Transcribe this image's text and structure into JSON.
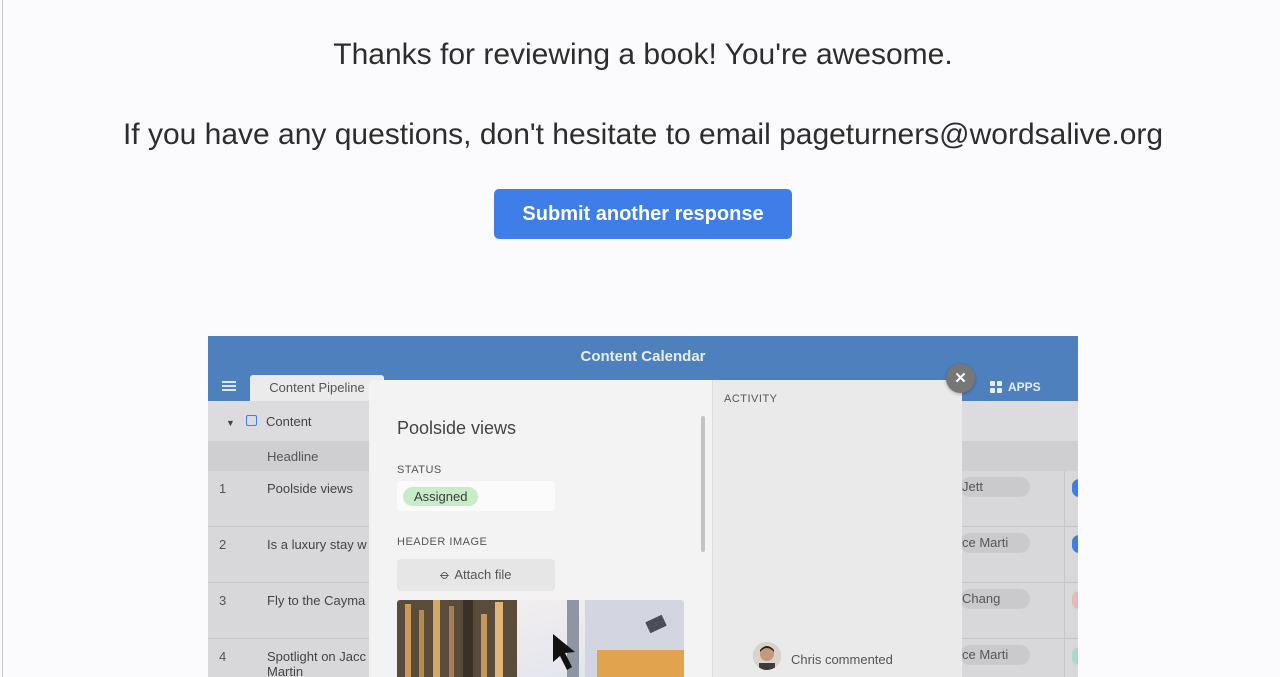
{
  "message": {
    "thanks": "Thanks for reviewing a book! You're awesome.",
    "questions": "If you have any questions, don't hesitate to email pageturners@wordsalive.org"
  },
  "submit_button": {
    "label": "Submit another response",
    "color": "#3f7ee8"
  },
  "preview": {
    "app_title": "Content Calendar",
    "tab": "Content Pipeline",
    "apps_label": "APPS",
    "section": "Content",
    "column_header": "Headline",
    "rows": [
      {
        "num": "1",
        "headline": "Poolside views",
        "person": "Jett",
        "dot_color": "#3f7ee8"
      },
      {
        "num": "2",
        "headline": "Is a luxury stay w",
        "person": "ce Marti",
        "dot_color": "#3f7ee8"
      },
      {
        "num": "3",
        "headline": "Fly to the Cayma",
        "person": "Chang",
        "dot_color": "#e6b8b8"
      },
      {
        "num": "4",
        "headline": "Spotlight on Jacc Martin",
        "person": "ce Marti",
        "dot_color": "#a9d9c9"
      }
    ],
    "record": {
      "title": "Poolside views",
      "status_label": "STATUS",
      "status_value": "Assigned",
      "header_image_label": "HEADER IMAGE",
      "attach_label": "Attach file"
    },
    "activity": {
      "label": "ACTIVITY",
      "comment": "Chris commented"
    },
    "colors": {
      "topbar": "#4e80be",
      "status_pill": "#c7ecc8"
    }
  }
}
